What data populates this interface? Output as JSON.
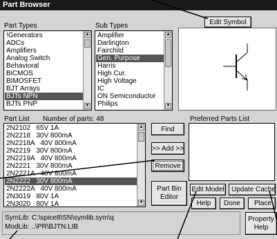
{
  "window": {
    "title": "Part Browser"
  },
  "part_types": {
    "label": "Part Types",
    "items": [
      "!Generators",
      "ADCs",
      "Amplifiers",
      "Analog Switch",
      "Behavioral",
      "BiCMOS",
      "BIMOSFET",
      "BJT Arrays",
      "BJTs NPN",
      "BJTs PNP"
    ],
    "selected_index": 8
  },
  "sub_types": {
    "label": "Sub Types",
    "items": [
      "Amplifier",
      "Darlington",
      "Fairchild",
      "Gen. Purpose",
      "Harris",
      "High Cur.",
      "High Voltage",
      "IC",
      "ON Semiconductor",
      "Philips"
    ],
    "selected_index": 3
  },
  "buttons": {
    "edit_symbol": "Edit Symbol",
    "find": "Find",
    "add": ">> Add >>",
    "remove": "Remove",
    "part_bin_editor_line1": "Part Bin",
    "part_bin_editor_line2": "Editor",
    "edit_model": "Edit Model",
    "update_cache": "Update Cache",
    "help": "Help",
    "done": "Done",
    "place": "Place",
    "property_help_line1": "Property",
    "property_help_line2": "Help"
  },
  "part_list": {
    "label": "Part List",
    "count_text": "Number of parts: 48",
    "items": [
      "2N2102   65V 1A",
      "2N2218   30V 800mA",
      "2N2218A   40V 800mA",
      "2N2219   30V 800mA",
      "2N2219A   40V 800mA",
      "2N2221   30V 800mA",
      "2N2221A   40V 800mA",
      "2N2222   30V 800mA",
      "2N2222A   40V 800mA",
      "2N3019   80V 1A",
      "2N3020   80V 1A"
    ],
    "selected_index": 7
  },
  "preferred": {
    "label": "Preferred Parts List"
  },
  "status": {
    "symlib": "SymLib:  C:\\spice8\\SN\\symlib.sym\\q",
    "modlib": "ModLib:  ..\\PR\\BJTN.LIB"
  },
  "icons": {
    "symbol": "npn-transistor-symbol",
    "scroll_up": "up-arrow-icon",
    "scroll_down": "down-arrow-icon"
  }
}
